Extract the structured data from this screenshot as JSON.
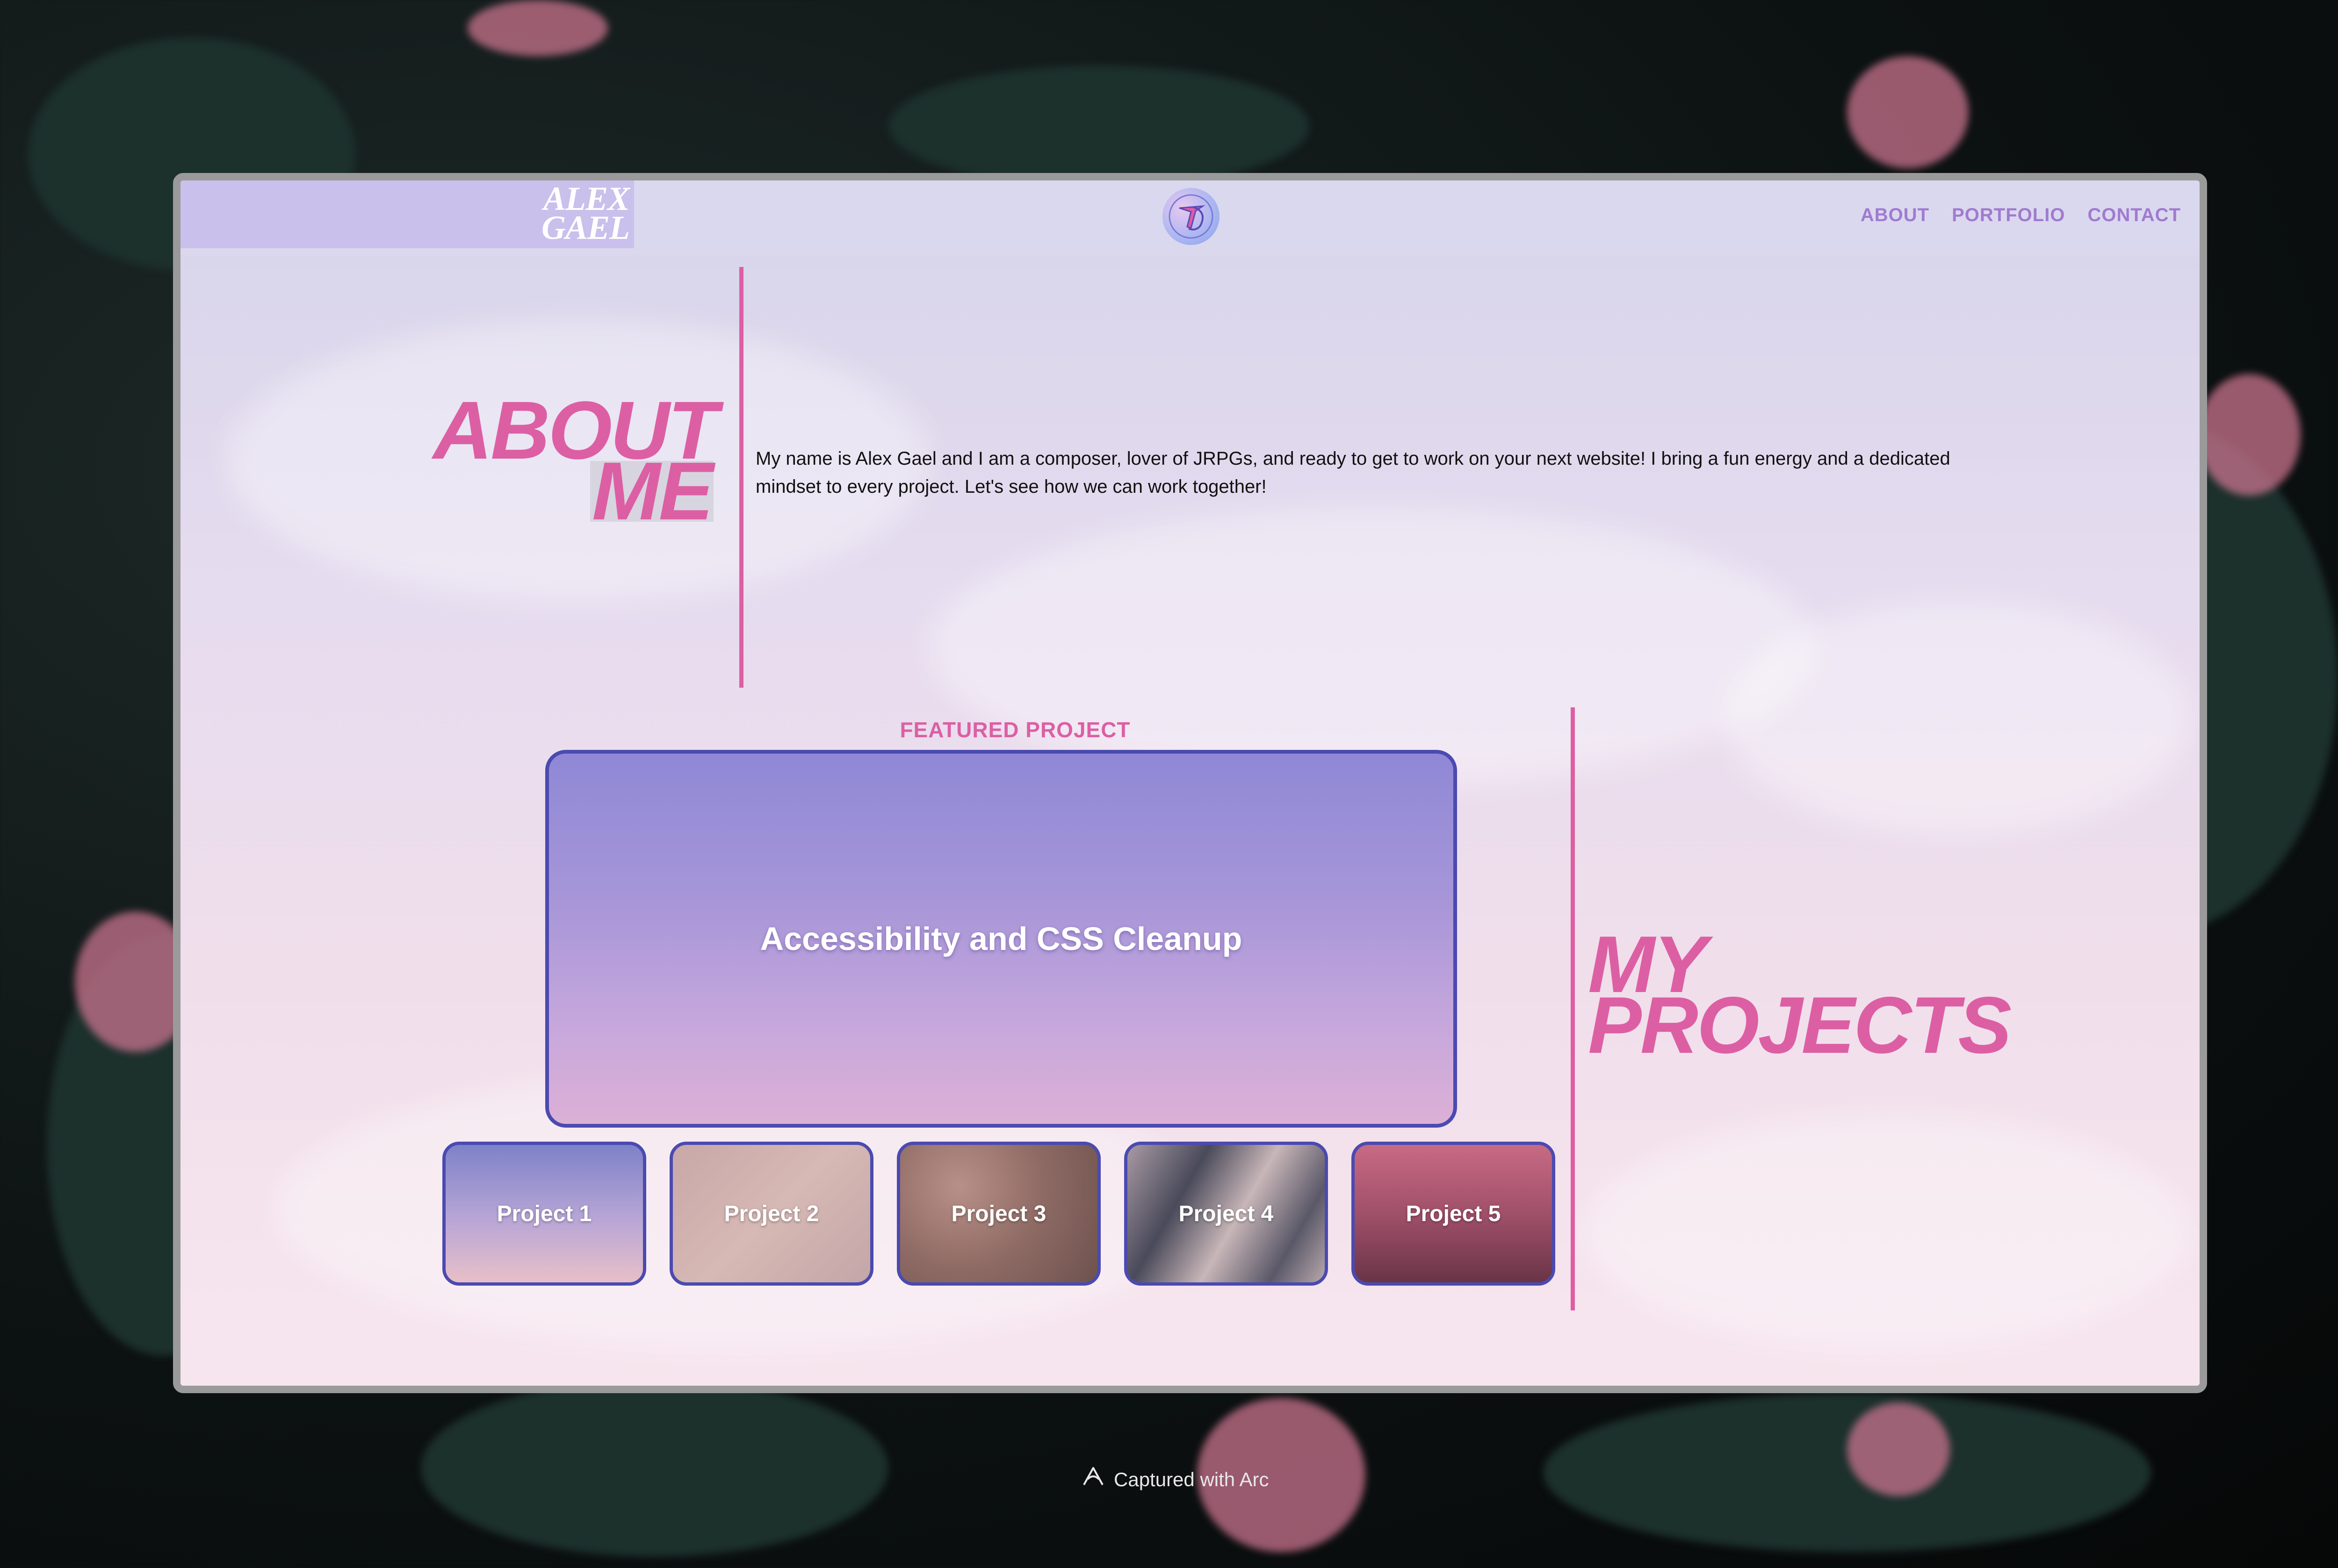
{
  "nav": {
    "logo_line1": "ALEX",
    "logo_line2": "GAEL",
    "links": [
      "ABOUT",
      "PORTFOLIO",
      "CONTACT"
    ]
  },
  "about": {
    "title_line1": "ABOUT",
    "title_line2": "ME",
    "text": "My name is Alex Gael and I am a composer, lover of JRPGs, and ready to get to work on your next website! I bring a fun energy and a dedicated mindset to every project. Let's see how we can work together!"
  },
  "featured": {
    "label": "FEATURED PROJECT",
    "title": "Accessibility and CSS Cleanup"
  },
  "projects": {
    "title_line1": "MY",
    "title_line2": "PROJECTS",
    "items": [
      "Project 1",
      "Project 2",
      "Project 3",
      "Project 4",
      "Project 5"
    ]
  },
  "footer": {
    "caption": "Captured with Arc"
  },
  "colors": {
    "accent_pink": "#dc5fa4",
    "card_border": "#4b4ab0",
    "nav_link": "#a07ad0"
  },
  "icons": {
    "nav_emblem": "logo-emblem-icon",
    "footer": "arc-icon"
  }
}
